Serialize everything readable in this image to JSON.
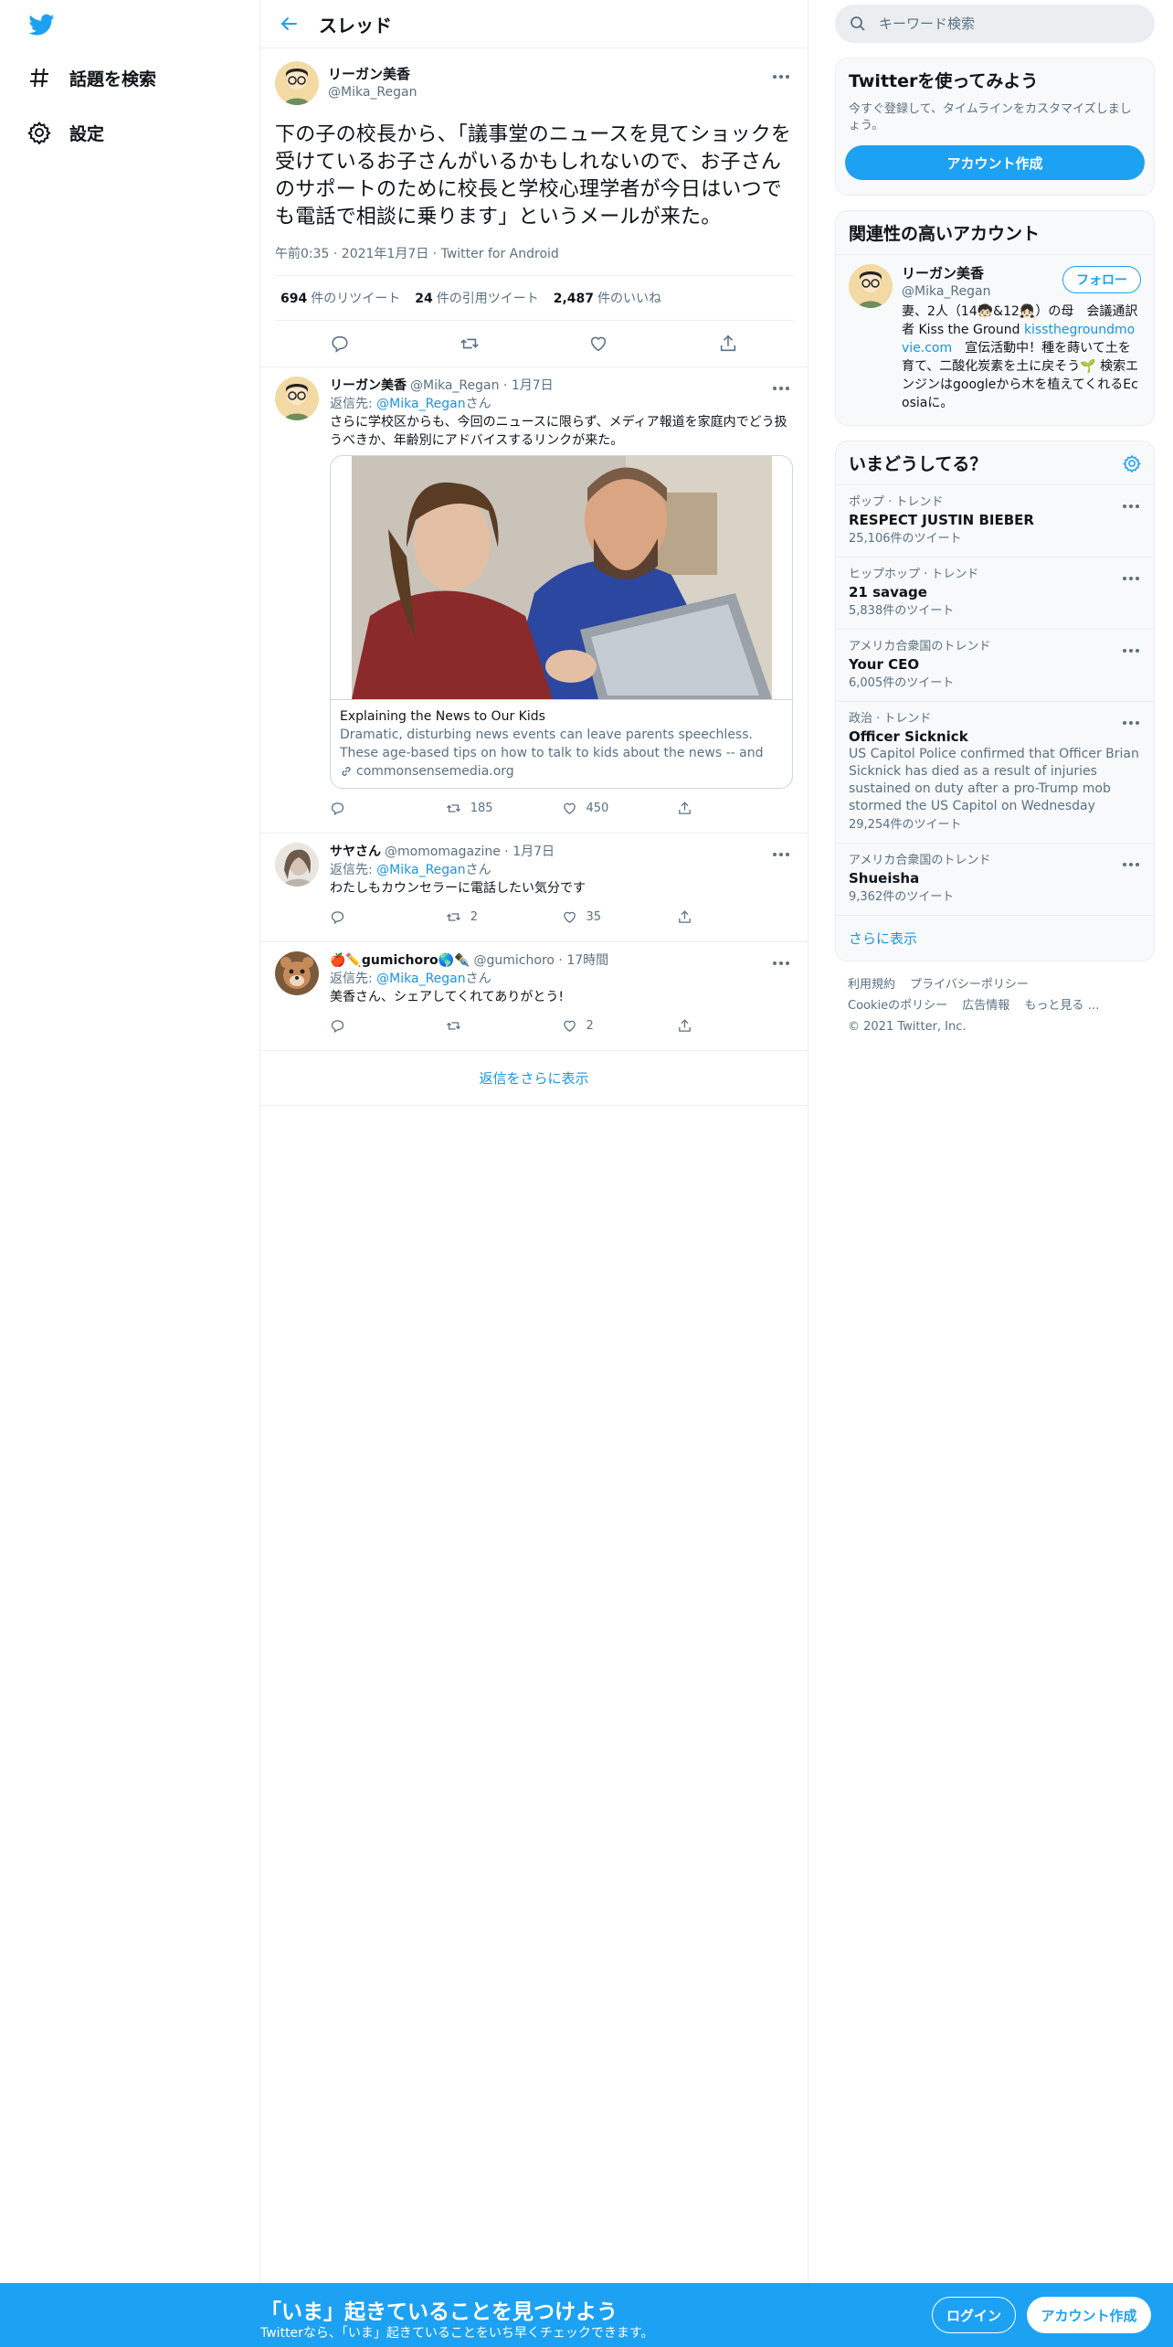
{
  "colors": {
    "brand": "#1da1f2",
    "link": "#1b95e0",
    "text": "#0f1419",
    "muted": "#5b7083",
    "border": "#ebeef0"
  },
  "nav": {
    "logo_icon": "twitter-bird-icon",
    "items": [
      {
        "label": "話題を検索",
        "icon": "hashtag-icon"
      },
      {
        "label": "設定",
        "icon": "gear-icon"
      }
    ]
  },
  "header": {
    "title": "スレッド",
    "back_icon": "arrow-left-icon"
  },
  "main_tweet": {
    "name": "リーガン美香",
    "handle": "@Mika_Regan",
    "text": "下の子の校長から、「議事堂のニュースを見てショックを受けているお子さんがいるかもしれないので、お子さんのサポートのために校長と学校心理学者が今日はいつでも電話で相談に乗ります」というメールが来た。",
    "meta": "午前0:35 · 2021年1月7日 · Twitter for Android",
    "stats": {
      "retweets_count": "694",
      "retweets_label": "件のリツイート",
      "quotes_count": "24",
      "quotes_label": "件の引用ツイート",
      "likes_count": "2,487",
      "likes_label": "件のいいね"
    }
  },
  "replies": [
    {
      "name": "リーガン美香",
      "handle": "@Mika_Regan",
      "date": "1月7日",
      "reply_prefix": "返信先: ",
      "reply_to": "@Mika_Regan",
      "reply_suffix": "さん",
      "text": "さらに学校区からも、今回のニュースに限らず、メディア報道を家庭内でどう扱うべきか、年齢別にアドバイスするリンクが来た。",
      "card": {
        "title": "Explaining the News to Our Kids",
        "description": "Dramatic, disturbing news events can leave parents speechless. These age-based tips on how to talk to kids about the news -- and listen, too -...",
        "domain": "commonsensemedia.org"
      },
      "retweets": "185",
      "likes": "450"
    },
    {
      "name": "サヤさん",
      "handle": "@momomagazine",
      "date": "1月7日",
      "reply_prefix": "返信先: ",
      "reply_to": "@Mika_Regan",
      "reply_suffix": "さん",
      "text": "わたしもカウンセラーに電話したい気分です",
      "retweets": "2",
      "likes": "35"
    },
    {
      "name": "🍎✏️gumichoro🌎✒️",
      "handle": "@gumichoro",
      "date": "17時間",
      "reply_prefix": "返信先: ",
      "reply_to": "@Mika_Regan",
      "reply_suffix": "さん",
      "text": "美香さん、シェアしてくれてありがとう!",
      "retweets": "",
      "likes": "2"
    }
  ],
  "show_more_replies": "返信をさらに表示",
  "search": {
    "placeholder": "キーワード検索"
  },
  "signup_panel": {
    "title": "Twitterを使ってみよう",
    "subtitle": "今すぐ登録して、タイムラインをカスタマイズしましょう。",
    "button": "アカウント作成"
  },
  "related": {
    "title": "関連性の高いアカウント",
    "name": "リーガン美香",
    "handle": "@Mika_Regan",
    "follow": "フォロー",
    "bio_1": "妻、2人（14🧒🏻&12👧🏻）の母　会議通訳者 Kiss the Ground ",
    "bio_link": "kissthegroundmovie.com",
    "bio_2": "　宣伝活動中！種を蒔いて土を育て、二酸化炭素を土に戻そう🌱 検索エンジンはgoogleから木を植えてくれるEcosiaに。"
  },
  "trends": {
    "title": "いまどうしてる？",
    "items": [
      {
        "context": "ポップ · トレンド",
        "name": "RESPECT JUSTIN BIEBER",
        "description": "",
        "count": "25,106件のツイート"
      },
      {
        "context": "ヒップホップ · トレンド",
        "name": "21 savage",
        "description": "",
        "count": "5,838件のツイート"
      },
      {
        "context": "アメリカ合衆国のトレンド",
        "name": "Your CEO",
        "description": "",
        "count": "6,005件のツイート"
      },
      {
        "context": "政治 · トレンド",
        "name": "Officer Sicknick",
        "description": "US Capitol Police confirmed that Officer Brian Sicknick has died as a result of injuries sustained on duty after a pro-Trump mob stormed the US Capitol on Wednesday",
        "count": "29,254件のツイート"
      },
      {
        "context": "アメリカ合衆国のトレンド",
        "name": "Shueisha",
        "description": "",
        "count": "9,362件のツイート"
      }
    ],
    "show_more": "さらに表示"
  },
  "footer": {
    "links": [
      "利用規約",
      "プライバシーポリシー",
      "Cookieのポリシー",
      "広告情報",
      "もっと見る …"
    ],
    "copyright": "© 2021 Twitter, Inc."
  },
  "banner": {
    "title": "「いま」起きていることを見つけよう",
    "subtitle": "Twitterなら、「いま」起きていることをいち早くチェックできます。",
    "login": "ログイン",
    "signup": "アカウント作成"
  }
}
